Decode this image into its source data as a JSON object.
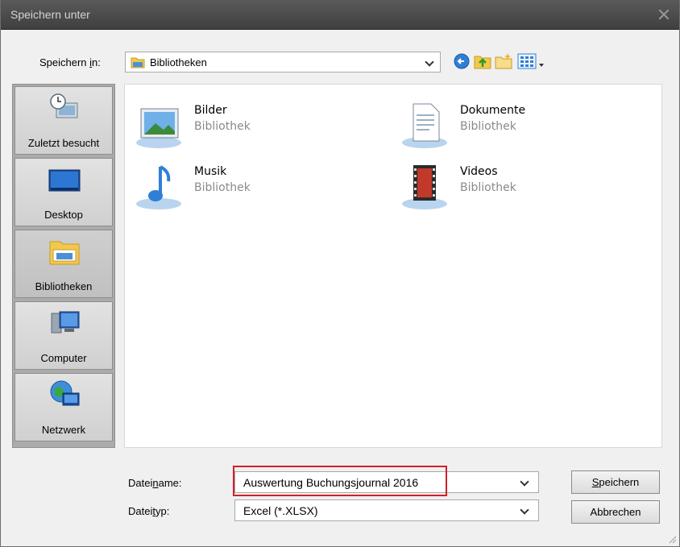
{
  "window": {
    "title": "Speichern unter"
  },
  "location": {
    "label_before": "Speichern ",
    "label_accel": "i",
    "label_after": "n:",
    "value": "Bibliotheken"
  },
  "toolbar": {
    "icons": [
      "back-icon",
      "up-folder-icon",
      "new-folder-icon",
      "view-menu-icon"
    ]
  },
  "places": [
    {
      "label": "Zuletzt besucht",
      "icon": "recent-places-icon"
    },
    {
      "label": "Desktop",
      "icon": "desktop-icon"
    },
    {
      "label": "Bibliotheken",
      "icon": "libraries-icon",
      "selected": true
    },
    {
      "label": "Computer",
      "icon": "computer-icon"
    },
    {
      "label": "Netzwerk",
      "icon": "network-icon"
    }
  ],
  "libraries": [
    {
      "name": "Bilder",
      "type": "Bibliothek",
      "icon": "pictures-library-icon"
    },
    {
      "name": "Dokumente",
      "type": "Bibliothek",
      "icon": "documents-library-icon"
    },
    {
      "name": "Musik",
      "type": "Bibliothek",
      "icon": "music-library-icon"
    },
    {
      "name": "Videos",
      "type": "Bibliothek",
      "icon": "videos-library-icon"
    }
  ],
  "filename": {
    "label_before": "Datei",
    "label_accel": "n",
    "label_after": "ame:",
    "value": "Auswertung Buchungsjournal 2016"
  },
  "filetype": {
    "label_before": "Datei",
    "label_accel": "t",
    "label_after": "yp:",
    "value": "Excel (*.XLSX)"
  },
  "buttons": {
    "save_accel": "S",
    "save_rest": "peichern",
    "cancel": "Abbrechen"
  },
  "colors": {
    "highlight": "#d0202a",
    "selection": "#c5c5c5"
  }
}
